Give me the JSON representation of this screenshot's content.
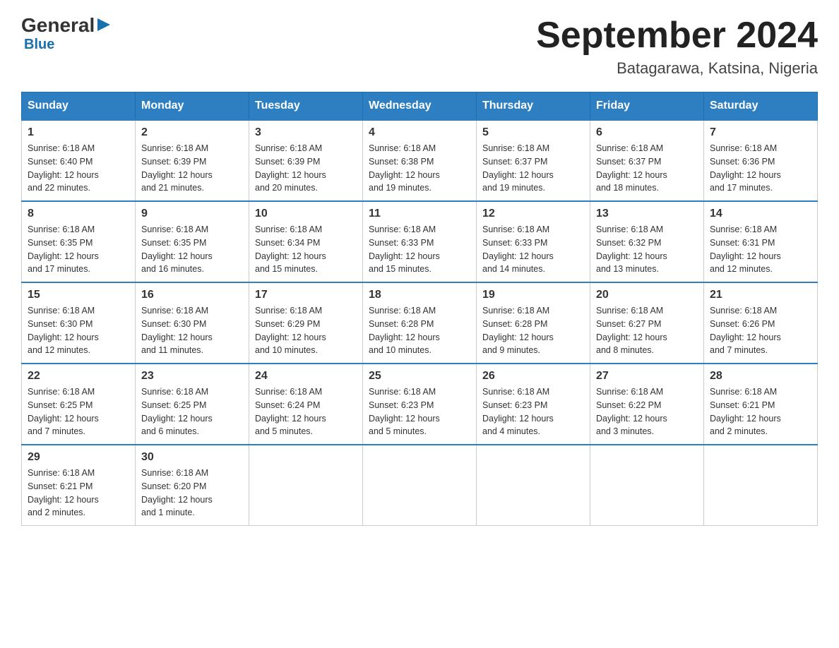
{
  "logo": {
    "general": "General",
    "blue": "Blue",
    "triangle": "▶"
  },
  "title": "September 2024",
  "subtitle": "Batagarawa, Katsina, Nigeria",
  "days_of_week": [
    "Sunday",
    "Monday",
    "Tuesday",
    "Wednesday",
    "Thursday",
    "Friday",
    "Saturday"
  ],
  "weeks": [
    [
      {
        "day": "1",
        "sunrise": "6:18 AM",
        "sunset": "6:40 PM",
        "daylight": "12 hours and 22 minutes."
      },
      {
        "day": "2",
        "sunrise": "6:18 AM",
        "sunset": "6:39 PM",
        "daylight": "12 hours and 21 minutes."
      },
      {
        "day": "3",
        "sunrise": "6:18 AM",
        "sunset": "6:39 PM",
        "daylight": "12 hours and 20 minutes."
      },
      {
        "day": "4",
        "sunrise": "6:18 AM",
        "sunset": "6:38 PM",
        "daylight": "12 hours and 19 minutes."
      },
      {
        "day": "5",
        "sunrise": "6:18 AM",
        "sunset": "6:37 PM",
        "daylight": "12 hours and 19 minutes."
      },
      {
        "day": "6",
        "sunrise": "6:18 AM",
        "sunset": "6:37 PM",
        "daylight": "12 hours and 18 minutes."
      },
      {
        "day": "7",
        "sunrise": "6:18 AM",
        "sunset": "6:36 PM",
        "daylight": "12 hours and 17 minutes."
      }
    ],
    [
      {
        "day": "8",
        "sunrise": "6:18 AM",
        "sunset": "6:35 PM",
        "daylight": "12 hours and 17 minutes."
      },
      {
        "day": "9",
        "sunrise": "6:18 AM",
        "sunset": "6:35 PM",
        "daylight": "12 hours and 16 minutes."
      },
      {
        "day": "10",
        "sunrise": "6:18 AM",
        "sunset": "6:34 PM",
        "daylight": "12 hours and 15 minutes."
      },
      {
        "day": "11",
        "sunrise": "6:18 AM",
        "sunset": "6:33 PM",
        "daylight": "12 hours and 15 minutes."
      },
      {
        "day": "12",
        "sunrise": "6:18 AM",
        "sunset": "6:33 PM",
        "daylight": "12 hours and 14 minutes."
      },
      {
        "day": "13",
        "sunrise": "6:18 AM",
        "sunset": "6:32 PM",
        "daylight": "12 hours and 13 minutes."
      },
      {
        "day": "14",
        "sunrise": "6:18 AM",
        "sunset": "6:31 PM",
        "daylight": "12 hours and 12 minutes."
      }
    ],
    [
      {
        "day": "15",
        "sunrise": "6:18 AM",
        "sunset": "6:30 PM",
        "daylight": "12 hours and 12 minutes."
      },
      {
        "day": "16",
        "sunrise": "6:18 AM",
        "sunset": "6:30 PM",
        "daylight": "12 hours and 11 minutes."
      },
      {
        "day": "17",
        "sunrise": "6:18 AM",
        "sunset": "6:29 PM",
        "daylight": "12 hours and 10 minutes."
      },
      {
        "day": "18",
        "sunrise": "6:18 AM",
        "sunset": "6:28 PM",
        "daylight": "12 hours and 10 minutes."
      },
      {
        "day": "19",
        "sunrise": "6:18 AM",
        "sunset": "6:28 PM",
        "daylight": "12 hours and 9 minutes."
      },
      {
        "day": "20",
        "sunrise": "6:18 AM",
        "sunset": "6:27 PM",
        "daylight": "12 hours and 8 minutes."
      },
      {
        "day": "21",
        "sunrise": "6:18 AM",
        "sunset": "6:26 PM",
        "daylight": "12 hours and 7 minutes."
      }
    ],
    [
      {
        "day": "22",
        "sunrise": "6:18 AM",
        "sunset": "6:25 PM",
        "daylight": "12 hours and 7 minutes."
      },
      {
        "day": "23",
        "sunrise": "6:18 AM",
        "sunset": "6:25 PM",
        "daylight": "12 hours and 6 minutes."
      },
      {
        "day": "24",
        "sunrise": "6:18 AM",
        "sunset": "6:24 PM",
        "daylight": "12 hours and 5 minutes."
      },
      {
        "day": "25",
        "sunrise": "6:18 AM",
        "sunset": "6:23 PM",
        "daylight": "12 hours and 5 minutes."
      },
      {
        "day": "26",
        "sunrise": "6:18 AM",
        "sunset": "6:23 PM",
        "daylight": "12 hours and 4 minutes."
      },
      {
        "day": "27",
        "sunrise": "6:18 AM",
        "sunset": "6:22 PM",
        "daylight": "12 hours and 3 minutes."
      },
      {
        "day": "28",
        "sunrise": "6:18 AM",
        "sunset": "6:21 PM",
        "daylight": "12 hours and 2 minutes."
      }
    ],
    [
      {
        "day": "29",
        "sunrise": "6:18 AM",
        "sunset": "6:21 PM",
        "daylight": "12 hours and 2 minutes."
      },
      {
        "day": "30",
        "sunrise": "6:18 AM",
        "sunset": "6:20 PM",
        "daylight": "12 hours and 1 minute."
      },
      null,
      null,
      null,
      null,
      null
    ]
  ],
  "labels": {
    "sunrise": "Sunrise:",
    "sunset": "Sunset:",
    "daylight": "Daylight:"
  }
}
